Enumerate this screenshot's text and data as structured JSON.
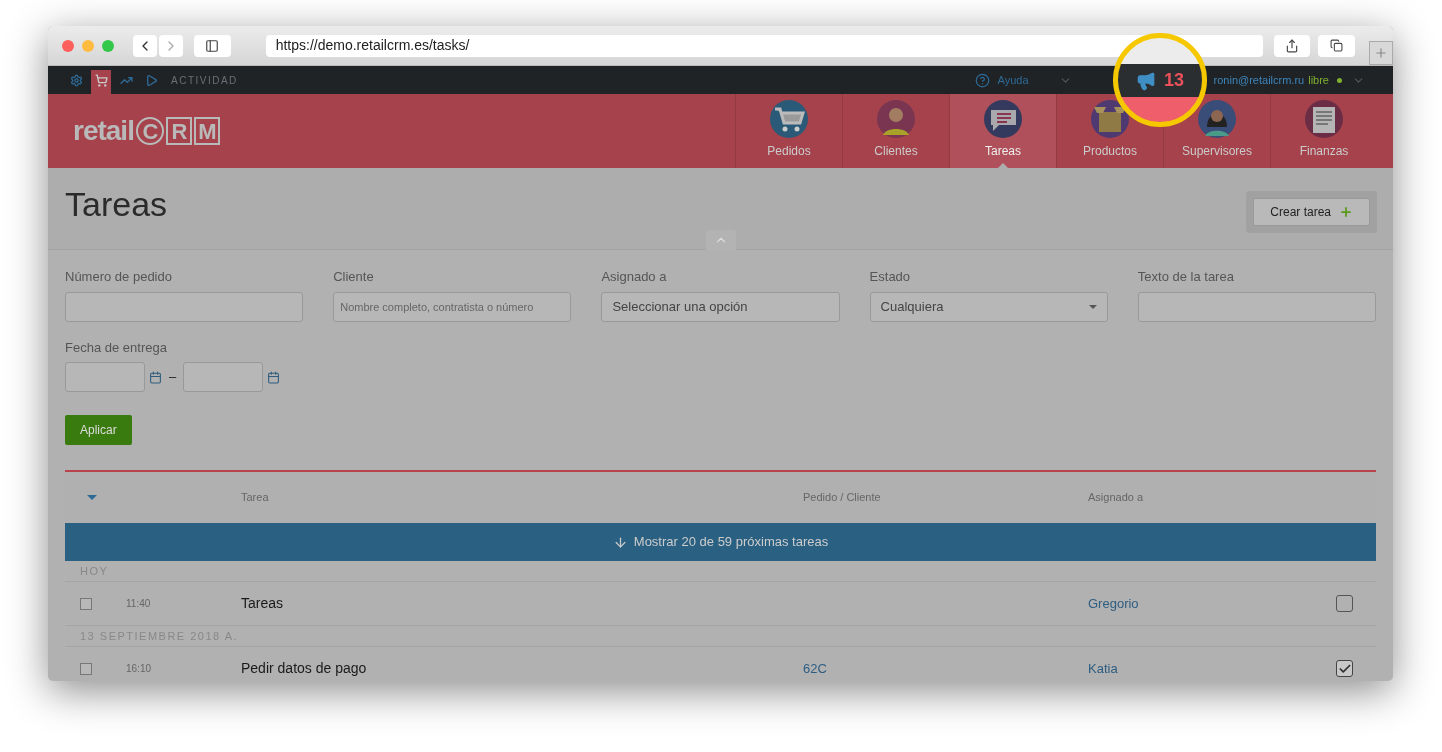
{
  "browser": {
    "url": "https://demo.retailcrm.es/tasks/"
  },
  "topbar": {
    "items": [
      {
        "selected": false
      },
      {
        "selected": true
      },
      {
        "selected": false
      },
      {
        "selected": false
      }
    ],
    "activity": "ACTIVIDAD",
    "help": "Ayuda",
    "notifications": "13",
    "user": "ronin@retailcrm.ru",
    "plan": "libre"
  },
  "logo": {
    "prefix": "retail",
    "letters": [
      "C",
      "R",
      "M"
    ]
  },
  "nav": [
    {
      "label": "Pedidos",
      "selected": false
    },
    {
      "label": "Clientes",
      "selected": false
    },
    {
      "label": "Tareas",
      "selected": true
    },
    {
      "label": "Productos",
      "selected": false
    },
    {
      "label": "Supervisores",
      "selected": false
    },
    {
      "label": "Finanzas",
      "selected": false
    }
  ],
  "page_title": "Tareas",
  "create_button": "Crear tarea",
  "filters": [
    {
      "kind": "text",
      "label": "Número de pedido"
    },
    {
      "kind": "text",
      "label": "Cliente",
      "placeholder": "Nombre completo, contratista o número"
    },
    {
      "kind": "combo",
      "label": "Asignado a",
      "placeholder": "Seleccionar una opción"
    },
    {
      "kind": "select",
      "label": "Estado",
      "value": "Cualquiera"
    },
    {
      "kind": "text",
      "label": "Texto de la tarea"
    }
  ],
  "date_filter": {
    "label": "Fecha de entrega",
    "separator": "–"
  },
  "apply_button": "Aplicar",
  "table": {
    "columns": [
      "Tarea",
      "Pedido / Cliente",
      "Asignado a"
    ],
    "load_more": "Mostrar 20 de 59 próximas tareas",
    "groups": [
      {
        "heading": "HOY",
        "rows": [
          {
            "checked": false,
            "time": "11:40",
            "title": "Tareas",
            "order": "",
            "assignee": "Gregorio",
            "done": false
          }
        ]
      },
      {
        "heading": "13 SEPTIEMBRE 2018 A.",
        "rows": [
          {
            "checked": false,
            "time": "16:10",
            "title": "Pedir datos de pago",
            "order": "62C",
            "assignee": "Katia",
            "done": true
          }
        ]
      }
    ]
  }
}
